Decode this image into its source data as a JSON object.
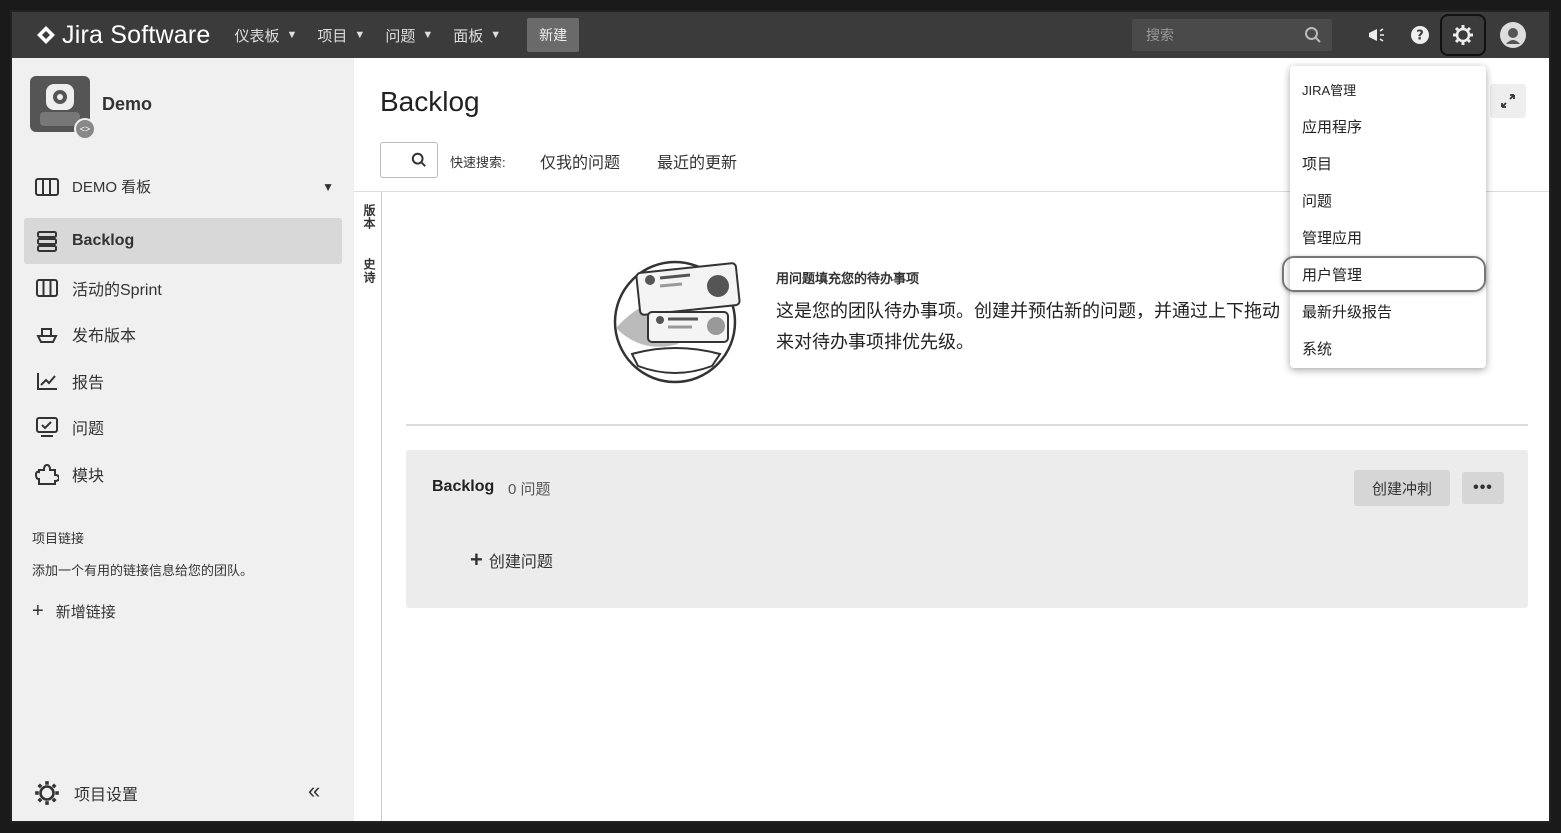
{
  "topbar": {
    "brand": "Jira Software",
    "nav": [
      {
        "label": "仪表板"
      },
      {
        "label": "项目"
      },
      {
        "label": "问题"
      },
      {
        "label": "面板"
      }
    ],
    "create_label": "新建",
    "search_placeholder": "搜索"
  },
  "sidebar": {
    "project_name": "Demo",
    "board_selector": "DEMO 看板",
    "items": [
      {
        "label": "Backlog",
        "icon": "backlog-icon"
      },
      {
        "label": "活动的Sprint",
        "icon": "board-icon"
      },
      {
        "label": "发布版本",
        "icon": "ship-icon"
      },
      {
        "label": "报告",
        "icon": "chart-icon"
      },
      {
        "label": "问题",
        "icon": "issues-icon"
      },
      {
        "label": "模块",
        "icon": "puzzle-icon"
      }
    ],
    "links_title": "项目链接",
    "links_desc": "添加一个有用的链接信息给您的团队。",
    "add_link": "新增链接",
    "settings": "项目设置",
    "collapse": "«"
  },
  "main": {
    "title": "Backlog",
    "quick_search_label": "快速搜索:",
    "quick_filters": [
      "仅我的问题",
      "最近的更新"
    ],
    "vertical_tabs": [
      "版本",
      "史诗"
    ],
    "empty_title": "用问题填充您的待办事项",
    "empty_desc": "这是您的团队待办事项。创建并预估新的问题，并通过上下拖动来对待办事项排优先级。",
    "backlog_title": "Backlog",
    "backlog_count": "0 问题",
    "create_sprint": "创建冲刺",
    "more": "•••",
    "create_issue": "创建问题"
  },
  "dropdown": {
    "items": [
      "JIRA管理",
      "应用程序",
      "项目",
      "问题",
      "管理应用",
      "用户管理",
      "最新升级报告",
      "系统"
    ]
  }
}
